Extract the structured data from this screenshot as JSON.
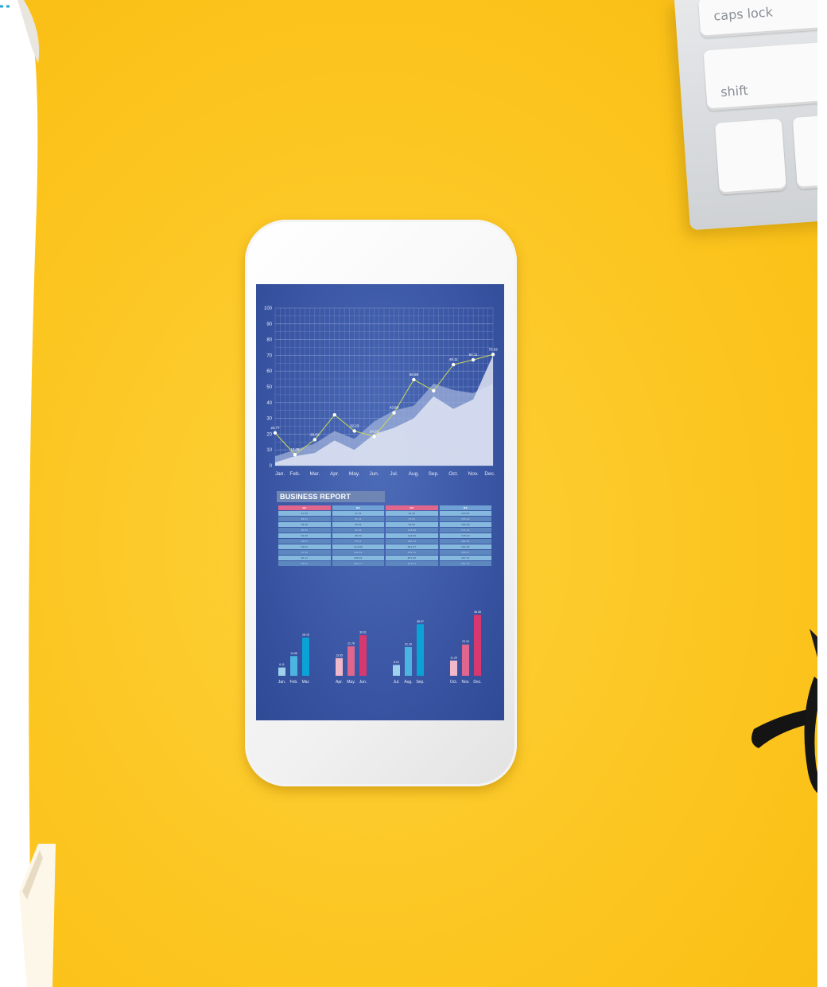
{
  "keyboard": {
    "caps_key": "caps lock",
    "shift_key": "shift"
  },
  "chart_data": [
    {
      "type": "area",
      "y_ticks": [
        "0",
        "10",
        "20",
        "30",
        "40",
        "50",
        "60",
        "70",
        "80",
        "90",
        "100"
      ],
      "ylim": [
        0,
        100
      ],
      "categories": [
        "Jan.",
        "Feb.",
        "Mar.",
        "Apr.",
        "May.",
        "Jun.",
        "Jul.",
        "Aug.",
        "Sep.",
        "Oct.",
        "Nov.",
        "Dec."
      ],
      "series": [
        {
          "values": [
            20.77,
            7,
            16.5,
            32.23,
            22,
            18.5,
            33.5,
            54.58,
            47.5,
            64.11,
            67.12,
            70.53
          ]
        },
        {
          "values": [
            6,
            10,
            14,
            22,
            17,
            28,
            35,
            38,
            52,
            48,
            46,
            52
          ]
        },
        {
          "values": [
            2,
            6,
            8,
            16,
            10,
            20,
            24,
            30,
            44,
            36,
            42,
            70
          ]
        }
      ],
      "data_labels": [
        "20.77",
        "19.09",
        "26.01",
        "32.23",
        "24.20",
        "43.89",
        "58.58",
        "49.11",
        "64.11",
        "70.53"
      ]
    },
    {
      "type": "table",
      "title": "BUSINESS REPORT",
      "headers": [
        "Q1",
        "Q2",
        "Q3",
        "Q4"
      ],
      "header_colors": [
        "#e0668d",
        "#6fa1d4",
        "#e0668d",
        "#6fa1d4"
      ],
      "rows": [
        [
          "21.20",
          "11.31",
          "24.20",
          "152.81"
        ],
        [
          "28.01",
          "21.11",
          "37.01",
          "155.40"
        ],
        [
          "18.06",
          "18.01",
          "28.00",
          "160.18"
        ],
        [
          "30.01",
          "22.31",
          "113.06",
          "171.11"
        ],
        [
          "24.30",
          "28.70",
          "116.00",
          "175.10"
        ],
        [
          "25.07",
          "33.11",
          "192.13",
          "182.31"
        ],
        [
          "34.01",
          "114.06",
          "201.27",
          "201.62"
        ],
        [
          "21.30",
          "122.31",
          "210.11",
          "206.17"
        ],
        [
          "30.11",
          "180.01",
          "207.45",
          "207.12"
        ],
        [
          "33.01",
          "201.77",
          "214.11",
          "211.77"
        ]
      ]
    },
    {
      "type": "bar",
      "groups": [
        {
          "categories": [
            "Jan.",
            "Feb.",
            "Mar."
          ],
          "values": [
            6.11,
            14.55,
            28.15
          ]
        },
        {
          "categories": [
            "Apr.",
            "May.",
            "Jun."
          ],
          "values": [
            13.05,
            21.78,
            30.01
          ]
        },
        {
          "categories": [
            "Jul.",
            "Aug.",
            "Sep."
          ],
          "values": [
            8.01,
            21.19,
            38.07
          ]
        },
        {
          "categories": [
            "Oct.",
            "Nov.",
            "Dec."
          ],
          "values": [
            11.25,
            23.1,
            45.08
          ]
        }
      ],
      "colors": [
        "#f0b8c9",
        "#e0668d",
        "#d6386f",
        "#9ed1ec",
        "#4cb4e0",
        "#0aa3d6"
      ]
    }
  ]
}
